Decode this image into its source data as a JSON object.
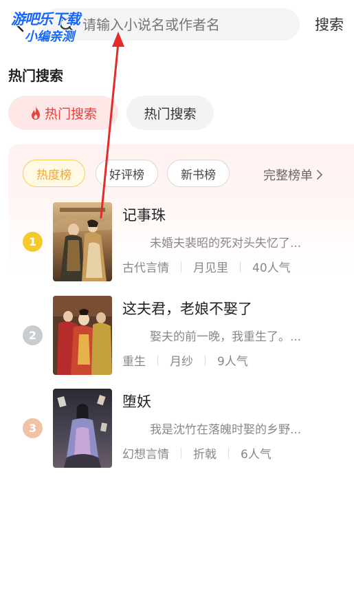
{
  "search": {
    "placeholder": "请输入小说名或作者名",
    "button_label": "搜索"
  },
  "watermark": {
    "line1": "游吧乐下载",
    "line2": "小编亲测"
  },
  "section": {
    "title": "热门搜索"
  },
  "chips": [
    {
      "label": "热门搜索",
      "active": true
    },
    {
      "label": "热门搜索",
      "active": false
    }
  ],
  "ranking": {
    "tabs": [
      {
        "label": "热度榜",
        "active": true
      },
      {
        "label": "好评榜",
        "active": false
      },
      {
        "label": "新书榜",
        "active": false
      }
    ],
    "full_list_label": "完整榜单",
    "books": [
      {
        "rank": "1",
        "title": "记事珠",
        "desc": "未婚夫裴昭的死对头失忆了...",
        "genre": "古代言情",
        "author": "月见里",
        "popularity": "40人气",
        "rank_color": "#f6c92b"
      },
      {
        "rank": "2",
        "title": "这夫君，老娘不娶了",
        "desc": "娶夫的前一晚，我重生了。...",
        "genre": "重生",
        "author": "月纱",
        "popularity": "9人气",
        "rank_color": "#c9ccd3"
      },
      {
        "rank": "3",
        "title": "堕妖",
        "desc": "我是沈竹在落魄时娶的乡野...",
        "genre": "幻想言情",
        "author": "折戟",
        "popularity": "6人气",
        "rank_color": "#efc3a3"
      }
    ]
  },
  "icons": {
    "back": "back-arrow-icon",
    "search": "search-icon",
    "flame": "flame-icon",
    "chevron": "chevron-right-icon"
  },
  "colors": {
    "accent_red": "#e8403c",
    "annotation_arrow": "#e32b2b",
    "tab_active": "#e8a93b"
  }
}
